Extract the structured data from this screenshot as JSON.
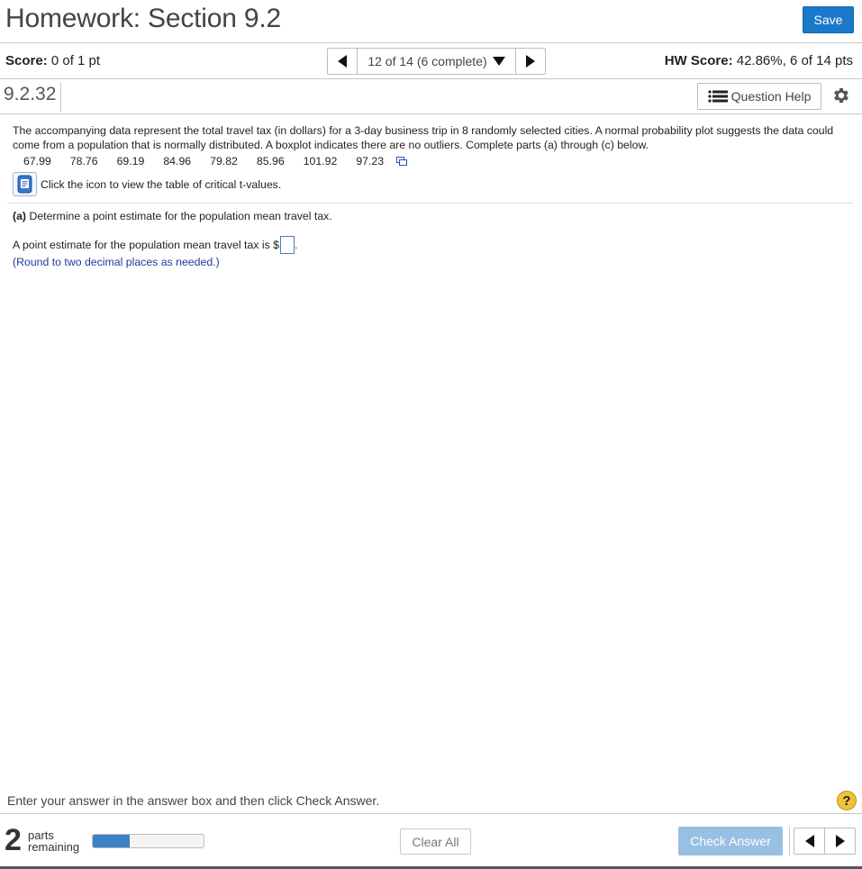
{
  "header": {
    "title": "Homework: Section 9.2",
    "save_label": "Save"
  },
  "score_bar": {
    "score_label": "Score:",
    "score_value": " 0 of 1 pt",
    "nav_text": "12 of 14 (6 complete)",
    "hw_score_label": "HW Score:",
    "hw_score_value": " 42.86%, 6 of 14 pts"
  },
  "question": {
    "number": "9.2.32",
    "help_label": "Question Help",
    "text": "The accompanying data represent the total travel tax (in dollars) for a 3-day business trip in 8 randomly selected cities. A normal probability plot suggests the data could come from a population that is normally distributed. A boxplot indicates there are no outliers. Complete parts (a) through (c) below.",
    "data_values": [
      "67.99",
      "78.76",
      "69.19",
      "84.96",
      "79.82",
      "85.96",
      "101.92",
      "97.23"
    ],
    "table_link": "Click the icon to view the table of critical t-values.",
    "part_a_label": "(a)",
    "part_a_text": " Determine a point estimate for the population mean travel tax.",
    "answer_prompt": "A point estimate for the population mean travel tax is $",
    "answer_suffix": ".",
    "round_note": "(Round to two decimal places as needed.)"
  },
  "footer": {
    "instructions": "Enter your answer in the answer box and then click Check Answer.",
    "help_glyph": "?",
    "parts_count": "2",
    "parts_label": "parts remaining",
    "progress_fraction": 0.33,
    "clear_label": "Clear All",
    "check_label": "Check Answer"
  },
  "colors": {
    "accent": "#1a79c9",
    "check_disabled": "#98c0e3",
    "progress": "#3b82c5",
    "note_text": "#1f3b9b",
    "help_circle": "#f0c33c"
  },
  "icons": [
    "prev-arrow-icon",
    "next-arrow-icon",
    "dropdown-arrow-icon",
    "list-icon",
    "gear-icon",
    "copy-icon",
    "book-icon",
    "help-icon"
  ]
}
